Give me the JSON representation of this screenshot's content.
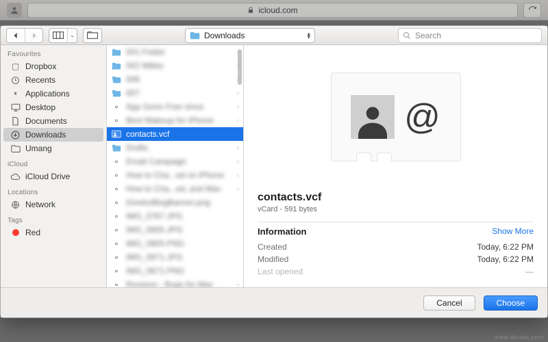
{
  "browser": {
    "domain": "icloud.com"
  },
  "dialog": {
    "location_label": "Downloads",
    "search_placeholder": "Search"
  },
  "sidebar": {
    "sections": [
      {
        "title": "Favourites",
        "items": [
          {
            "icon": "folder",
            "label": "Dropbox"
          },
          {
            "icon": "clock",
            "label": "Recents"
          },
          {
            "icon": "apps",
            "label": "Applications"
          },
          {
            "icon": "desktop",
            "label": "Desktop"
          },
          {
            "icon": "doc",
            "label": "Documents"
          },
          {
            "icon": "downloads",
            "label": "Downloads",
            "selected": true
          },
          {
            "icon": "folder",
            "label": "Umang"
          }
        ]
      },
      {
        "title": "iCloud",
        "items": [
          {
            "icon": "cloud",
            "label": "iCloud Drive"
          }
        ]
      },
      {
        "title": "Locations",
        "items": [
          {
            "icon": "globe",
            "label": "Network"
          }
        ]
      },
      {
        "title": "Tags",
        "items": [
          {
            "icon": "tag-red",
            "label": "Red"
          }
        ]
      }
    ]
  },
  "files": {
    "selected_label": "contacts.vcf"
  },
  "preview": {
    "title": "contacts.vcf",
    "subtitle": "vCard - 591 bytes",
    "info_heading": "Information",
    "show_more": "Show More",
    "rows": [
      {
        "k": "Created",
        "v": "Today, 6:22 PM"
      },
      {
        "k": "Modified",
        "v": "Today, 6:22 PM"
      },
      {
        "k": "Last opened",
        "v": "—"
      }
    ]
  },
  "footer": {
    "cancel": "Cancel",
    "choose": "Choose"
  },
  "watermark": "www.deuaq.com"
}
